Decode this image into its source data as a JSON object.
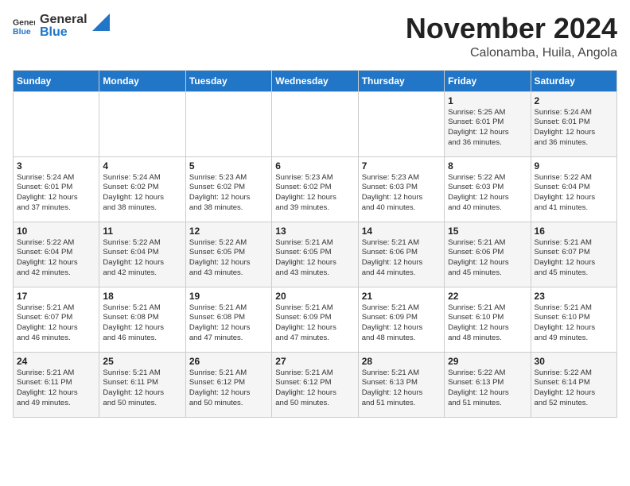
{
  "header": {
    "logo_general": "General",
    "logo_blue": "Blue",
    "month_year": "November 2024",
    "location": "Calonamba, Huila, Angola"
  },
  "weekdays": [
    "Sunday",
    "Monday",
    "Tuesday",
    "Wednesday",
    "Thursday",
    "Friday",
    "Saturday"
  ],
  "weeks": [
    [
      {
        "day": "",
        "info": ""
      },
      {
        "day": "",
        "info": ""
      },
      {
        "day": "",
        "info": ""
      },
      {
        "day": "",
        "info": ""
      },
      {
        "day": "",
        "info": ""
      },
      {
        "day": "1",
        "info": "Sunrise: 5:25 AM\nSunset: 6:01 PM\nDaylight: 12 hours\nand 36 minutes."
      },
      {
        "day": "2",
        "info": "Sunrise: 5:24 AM\nSunset: 6:01 PM\nDaylight: 12 hours\nand 36 minutes."
      }
    ],
    [
      {
        "day": "3",
        "info": "Sunrise: 5:24 AM\nSunset: 6:01 PM\nDaylight: 12 hours\nand 37 minutes."
      },
      {
        "day": "4",
        "info": "Sunrise: 5:24 AM\nSunset: 6:02 PM\nDaylight: 12 hours\nand 38 minutes."
      },
      {
        "day": "5",
        "info": "Sunrise: 5:23 AM\nSunset: 6:02 PM\nDaylight: 12 hours\nand 38 minutes."
      },
      {
        "day": "6",
        "info": "Sunrise: 5:23 AM\nSunset: 6:02 PM\nDaylight: 12 hours\nand 39 minutes."
      },
      {
        "day": "7",
        "info": "Sunrise: 5:23 AM\nSunset: 6:03 PM\nDaylight: 12 hours\nand 40 minutes."
      },
      {
        "day": "8",
        "info": "Sunrise: 5:22 AM\nSunset: 6:03 PM\nDaylight: 12 hours\nand 40 minutes."
      },
      {
        "day": "9",
        "info": "Sunrise: 5:22 AM\nSunset: 6:04 PM\nDaylight: 12 hours\nand 41 minutes."
      }
    ],
    [
      {
        "day": "10",
        "info": "Sunrise: 5:22 AM\nSunset: 6:04 PM\nDaylight: 12 hours\nand 42 minutes."
      },
      {
        "day": "11",
        "info": "Sunrise: 5:22 AM\nSunset: 6:04 PM\nDaylight: 12 hours\nand 42 minutes."
      },
      {
        "day": "12",
        "info": "Sunrise: 5:22 AM\nSunset: 6:05 PM\nDaylight: 12 hours\nand 43 minutes."
      },
      {
        "day": "13",
        "info": "Sunrise: 5:21 AM\nSunset: 6:05 PM\nDaylight: 12 hours\nand 43 minutes."
      },
      {
        "day": "14",
        "info": "Sunrise: 5:21 AM\nSunset: 6:06 PM\nDaylight: 12 hours\nand 44 minutes."
      },
      {
        "day": "15",
        "info": "Sunrise: 5:21 AM\nSunset: 6:06 PM\nDaylight: 12 hours\nand 45 minutes."
      },
      {
        "day": "16",
        "info": "Sunrise: 5:21 AM\nSunset: 6:07 PM\nDaylight: 12 hours\nand 45 minutes."
      }
    ],
    [
      {
        "day": "17",
        "info": "Sunrise: 5:21 AM\nSunset: 6:07 PM\nDaylight: 12 hours\nand 46 minutes."
      },
      {
        "day": "18",
        "info": "Sunrise: 5:21 AM\nSunset: 6:08 PM\nDaylight: 12 hours\nand 46 minutes."
      },
      {
        "day": "19",
        "info": "Sunrise: 5:21 AM\nSunset: 6:08 PM\nDaylight: 12 hours\nand 47 minutes."
      },
      {
        "day": "20",
        "info": "Sunrise: 5:21 AM\nSunset: 6:09 PM\nDaylight: 12 hours\nand 47 minutes."
      },
      {
        "day": "21",
        "info": "Sunrise: 5:21 AM\nSunset: 6:09 PM\nDaylight: 12 hours\nand 48 minutes."
      },
      {
        "day": "22",
        "info": "Sunrise: 5:21 AM\nSunset: 6:10 PM\nDaylight: 12 hours\nand 48 minutes."
      },
      {
        "day": "23",
        "info": "Sunrise: 5:21 AM\nSunset: 6:10 PM\nDaylight: 12 hours\nand 49 minutes."
      }
    ],
    [
      {
        "day": "24",
        "info": "Sunrise: 5:21 AM\nSunset: 6:11 PM\nDaylight: 12 hours\nand 49 minutes."
      },
      {
        "day": "25",
        "info": "Sunrise: 5:21 AM\nSunset: 6:11 PM\nDaylight: 12 hours\nand 50 minutes."
      },
      {
        "day": "26",
        "info": "Sunrise: 5:21 AM\nSunset: 6:12 PM\nDaylight: 12 hours\nand 50 minutes."
      },
      {
        "day": "27",
        "info": "Sunrise: 5:21 AM\nSunset: 6:12 PM\nDaylight: 12 hours\nand 50 minutes."
      },
      {
        "day": "28",
        "info": "Sunrise: 5:21 AM\nSunset: 6:13 PM\nDaylight: 12 hours\nand 51 minutes."
      },
      {
        "day": "29",
        "info": "Sunrise: 5:22 AM\nSunset: 6:13 PM\nDaylight: 12 hours\nand 51 minutes."
      },
      {
        "day": "30",
        "info": "Sunrise: 5:22 AM\nSunset: 6:14 PM\nDaylight: 12 hours\nand 52 minutes."
      }
    ]
  ]
}
